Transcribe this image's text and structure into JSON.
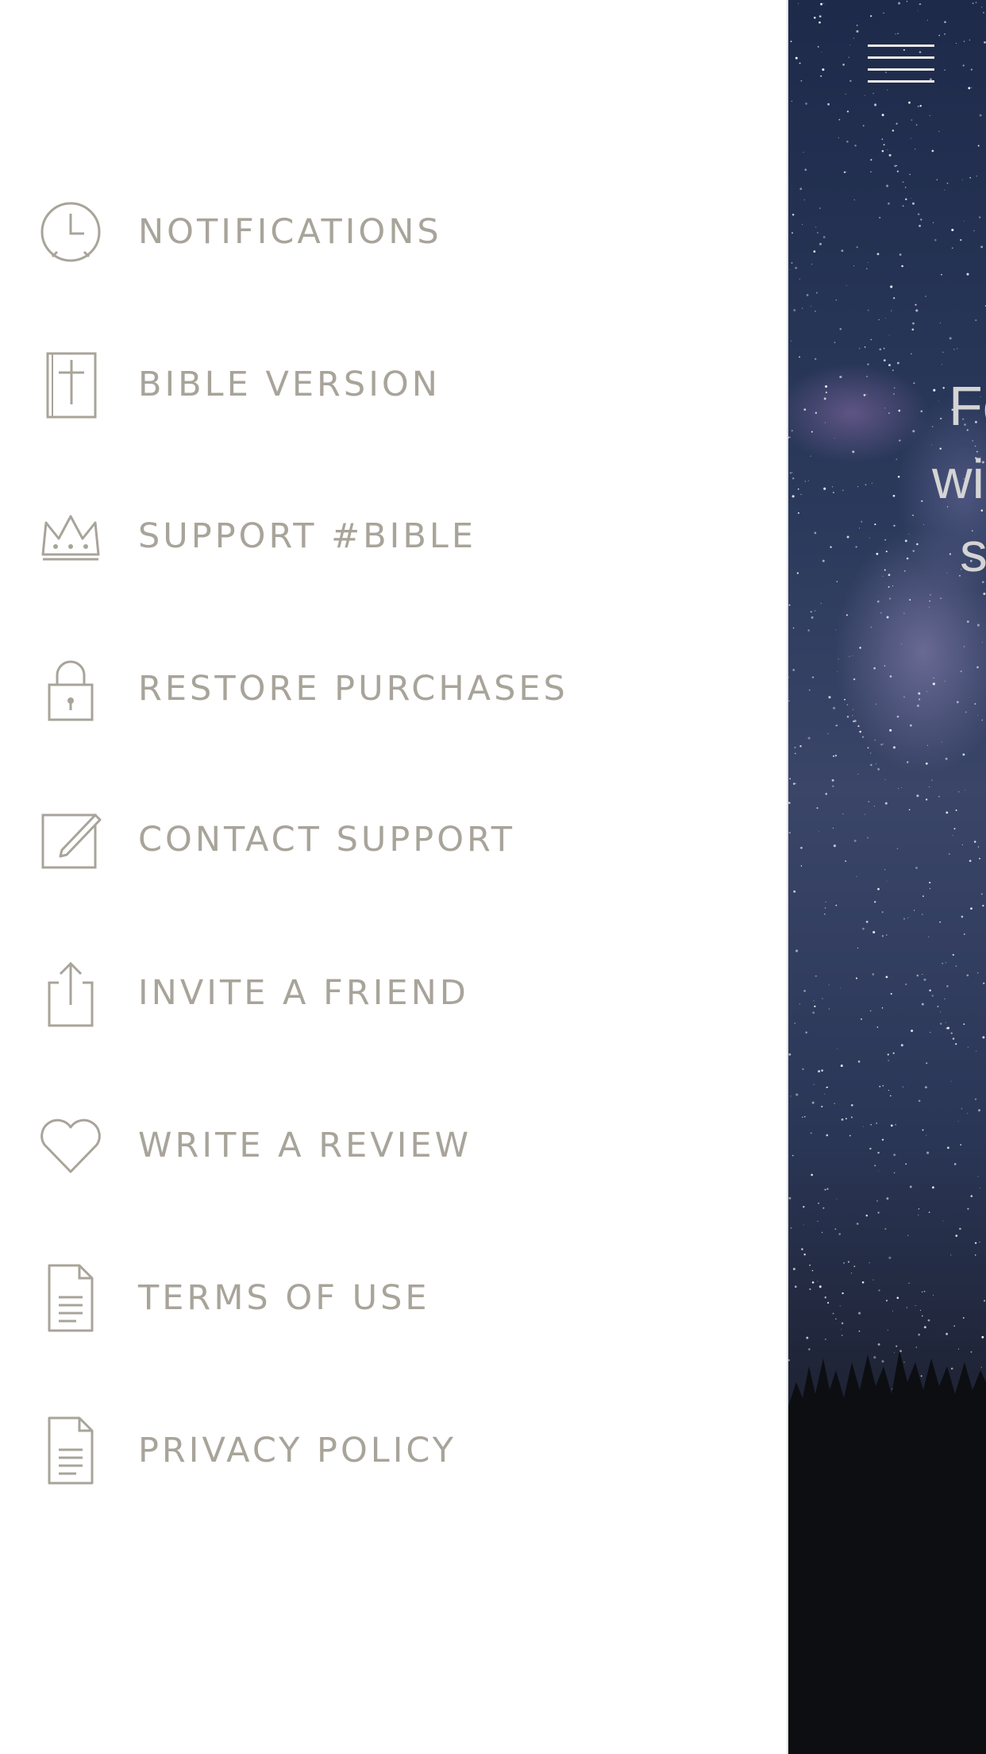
{
  "app": {
    "hero_lines": [
      "Fo",
      "wi",
      "s"
    ]
  },
  "topbar": {
    "menu_icon": "hamburger-icon"
  },
  "drawer": {
    "items": [
      {
        "label": "NOTIFICATIONS",
        "icon": "clock-icon"
      },
      {
        "label": "BIBLE VERSION",
        "icon": "bible-icon"
      },
      {
        "label": "SUPPORT #BIBLE",
        "icon": "crown-icon"
      },
      {
        "label": "RESTORE PURCHASES",
        "icon": "lock-icon"
      },
      {
        "label": "CONTACT SUPPORT",
        "icon": "compose-icon"
      },
      {
        "label": "INVITE A FRIEND",
        "icon": "share-icon"
      },
      {
        "label": "WRITE A REVIEW",
        "icon": "heart-icon"
      },
      {
        "label": "TERMS OF USE",
        "icon": "document-icon"
      },
      {
        "label": "PRIVACY POLICY",
        "icon": "document-icon"
      }
    ]
  },
  "colors": {
    "drawer_bg": "#ffffff",
    "label_text": "#a8a49a",
    "icon_stroke": "#a8a49a",
    "sky_top": "#1e2a4a",
    "sky_bottom": "#0d0f14"
  }
}
